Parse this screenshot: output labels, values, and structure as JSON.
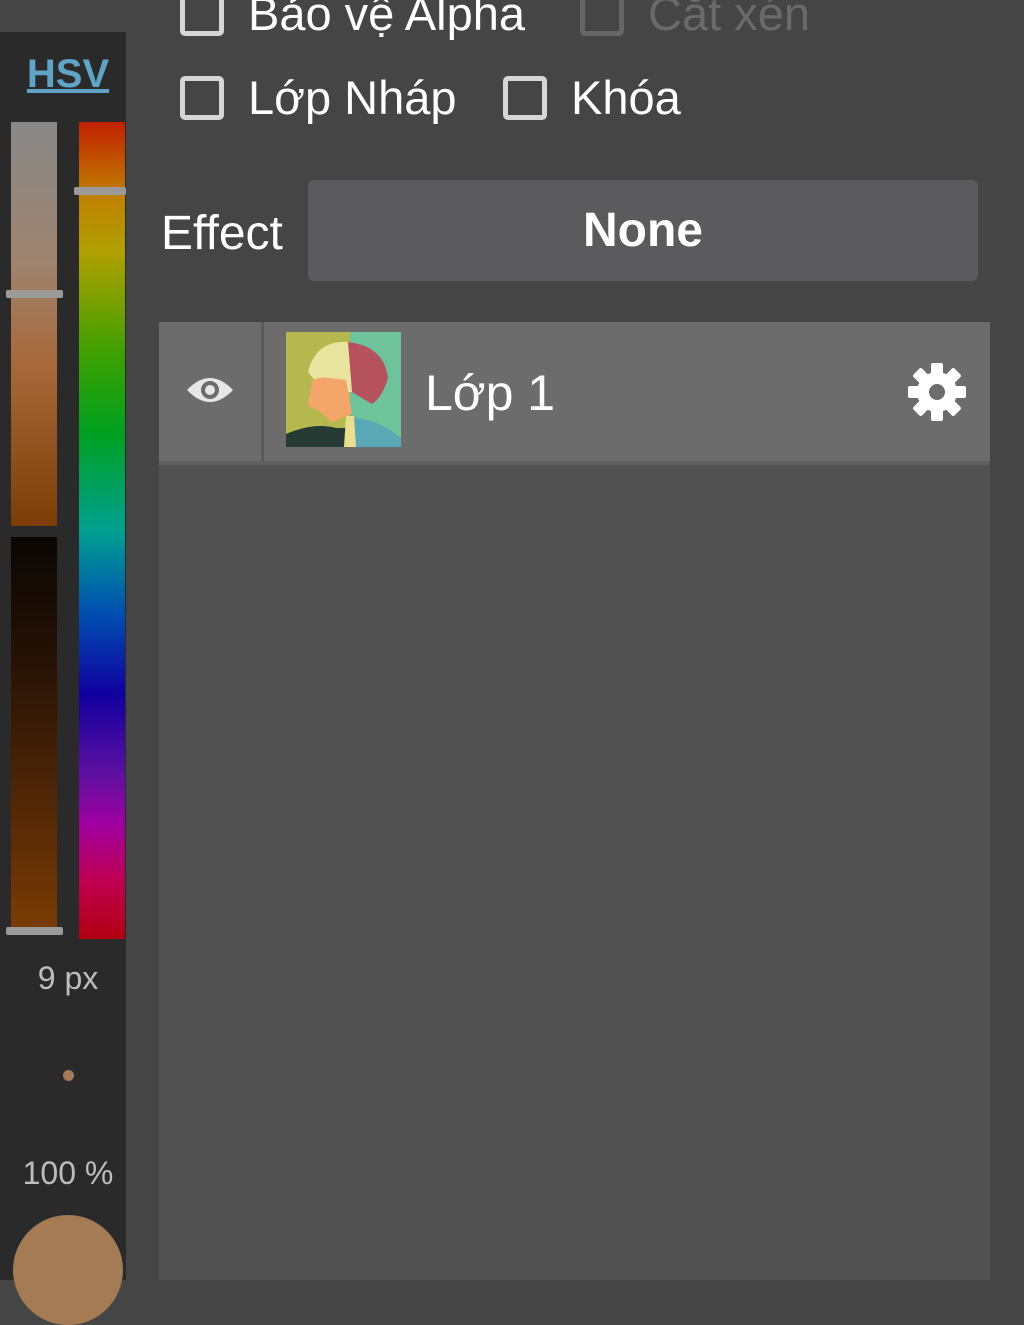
{
  "color_panel": {
    "mode_label": "HSV",
    "brush_size": "9 px",
    "opacity": "100 %",
    "current_color": "#a57b55"
  },
  "options": {
    "alpha_protect": "Bảo vệ Alpha",
    "clipping": "Cắt xén",
    "draft_layer": "Lớp Nháp",
    "lock": "Khóa"
  },
  "effect": {
    "label": "Effect",
    "value": "None"
  },
  "layers": [
    {
      "name": "Lớp 1",
      "visible": true
    }
  ],
  "icons": [
    "eye-icon",
    "gear-icon"
  ]
}
